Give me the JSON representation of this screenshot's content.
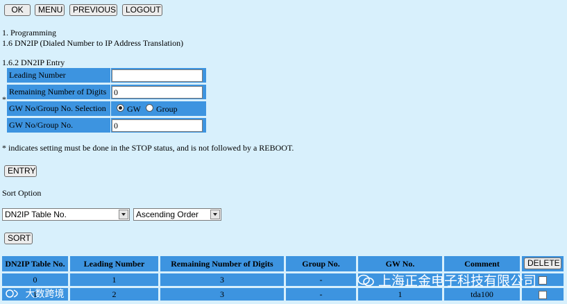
{
  "toolbar": {
    "ok_label": "OK",
    "menu_label": "MENU",
    "previous_label": "PREVIOUS",
    "logout_label": "LOGOUT"
  },
  "breadcrumb": {
    "line1": "1. Programming",
    "line2": "1.6 DN2IP (Dialed Number to IP Address Translation)"
  },
  "section_title": "1.6.2 DN2IP Entry",
  "entry_form": {
    "required_mark": "*",
    "leading_number": {
      "label": "Leading Number",
      "value": ""
    },
    "remaining_digits": {
      "label": "Remaining Number of Digits",
      "value": "0"
    },
    "selection": {
      "label": "GW No/Group No. Selection",
      "options": [
        "GW",
        "Group"
      ],
      "selected": "GW"
    },
    "gw_group_no": {
      "label": "GW No/Group No.",
      "value": "0"
    }
  },
  "note": "* indicates setting must be done in the STOP status, and is not followed by a REBOOT.",
  "entry_button": "ENTRY",
  "sort": {
    "title": "Sort Option",
    "field_value": "DN2IP Table No.",
    "order_value": "Ascending Order",
    "button": "SORT"
  },
  "table": {
    "headers": [
      "DN2IP Table No.",
      "Leading Number",
      "Remaining Number of Digits",
      "Group No.",
      "GW No.",
      "Comment"
    ],
    "delete_label": "DELETE",
    "rows": [
      [
        "0",
        "1",
        "3",
        "-",
        "",
        ""
      ],
      [
        "1",
        "2",
        "3",
        "-",
        "1",
        "tda100"
      ]
    ]
  },
  "watermarks": {
    "company": "上海正金电子科技有限公司",
    "brand": "大数跨境"
  },
  "colors": {
    "page_bg": "#d8f0fc",
    "cell_bg": "#3d94e0",
    "button_bg": "#ececec"
  }
}
